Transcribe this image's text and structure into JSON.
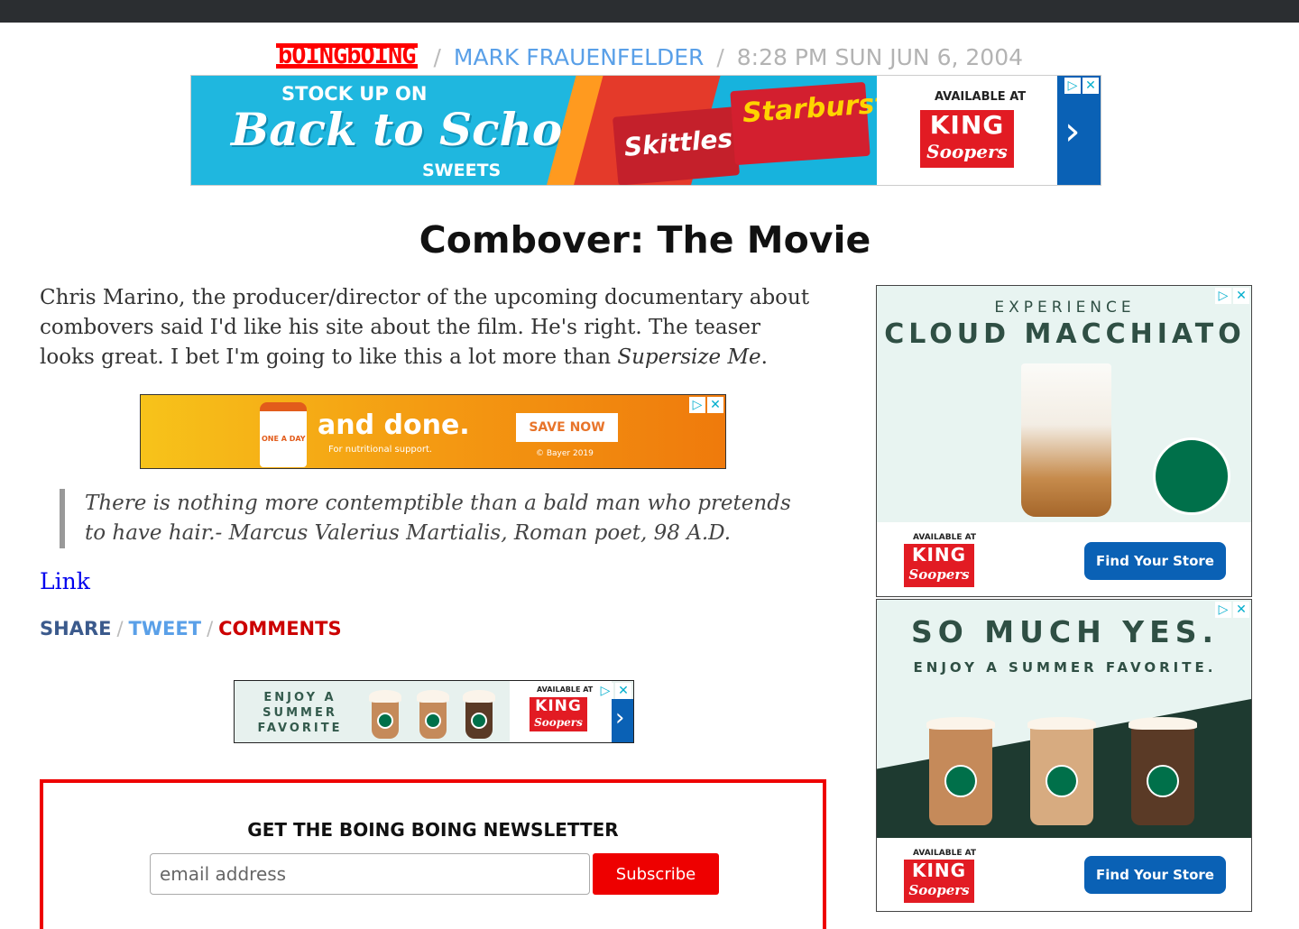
{
  "header": {
    "logo": "bOINGbOING",
    "separator": "/",
    "author": "MARK FRAUENFELDER",
    "date": "8:28 PM SUN JUN 6, 2004"
  },
  "ads": {
    "top_banner": {
      "headline_small": "STOCK UP ON",
      "headline": "Back to School",
      "headline_bottom": "SWEETS",
      "candy1": "Skittles",
      "candy2": "Starburst",
      "available_at": "AVAILABLE AT",
      "store_line1": "KING",
      "store_line2": "Soopers"
    },
    "done_banner": {
      "bottle_label": "ONE A DAY",
      "headline": "and done.",
      "subline": "For nutritional support.",
      "cta": "SAVE NOW",
      "copyright": "© Bayer 2019"
    },
    "small_banner": {
      "line": "ENJOY A SUMMER FAVORITE",
      "available_at": "AVAILABLE AT",
      "store_line1": "KING",
      "store_line2": "Soopers"
    },
    "side1": {
      "eyebrow": "EXPERIENCE",
      "headline": "CLOUD MACCHIATO",
      "available_at": "AVAILABLE AT",
      "store_line1": "KING",
      "store_line2": "Soopers",
      "cta": "Find Your Store"
    },
    "side2": {
      "headline": "SO MUCH YES.",
      "subline": "ENJOY A SUMMER FAVORITE.",
      "available_at": "AVAILABLE AT",
      "store_line1": "KING",
      "store_line2": "Soopers",
      "cta": "Find Your Store"
    },
    "adchoices_icon": "ad-choices-icon",
    "close_icon": "close-icon"
  },
  "article": {
    "title": "Combover: The Movie",
    "body_before": "Chris Marino, the producer/director of the upcoming documentary about combovers said I'd like his site about the film. He's right. The teaser looks great. I bet I'm going to like this a lot more than ",
    "body_em": "Supersize Me",
    "body_after": ".",
    "quote": "There is nothing more contemptible than a bald man who pretends to have hair.- Marcus Valerius Martialis, Roman poet, 98 A.D.",
    "link_label": "Link"
  },
  "share_bar": {
    "share": "SHARE",
    "tweet": "TWEET",
    "comments": "COMMENTS",
    "separator": "/"
  },
  "newsletter": {
    "title": "GET THE BOING BOING NEWSLETTER",
    "placeholder": "email address",
    "button": "Subscribe"
  },
  "colors": {
    "brand_red": "#ff0000",
    "author_blue": "#5aa0e8",
    "share_blue": "#3b5a8c",
    "comments_red": "#cc0000",
    "newsletter_border": "#ee0000"
  }
}
